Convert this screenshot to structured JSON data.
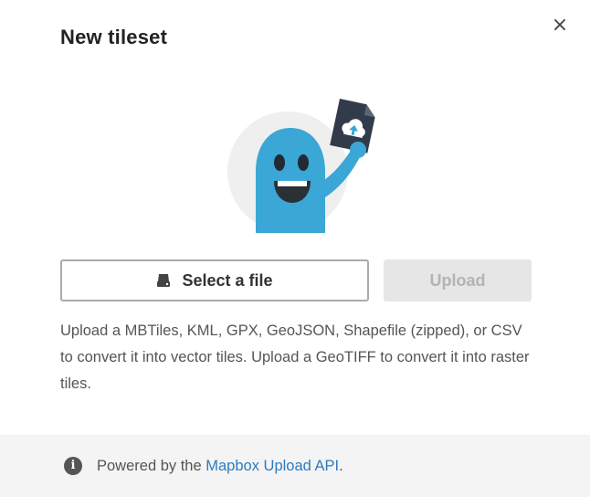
{
  "modal": {
    "title": "New tileset",
    "close_label": "×"
  },
  "actions": {
    "select_file_label": "Select a file",
    "select_file_icon": "hard-drive-icon",
    "upload_label": "Upload",
    "upload_disabled": true
  },
  "description": "Upload a MBTiles, KML, GPX, GeoJSON, Shapefile (zipped), or CSV to convert it into vector tiles. Upload a GeoTIFF to convert it into raster tiles.",
  "footer": {
    "icon": "info-icon",
    "prefix": "Powered by the ",
    "link_text": "Mapbox Upload API",
    "suffix": "."
  },
  "colors": {
    "accent_link": "#2d7bbf",
    "mascot": "#3aa7d6",
    "disabled_button": "#e6e6e6"
  }
}
